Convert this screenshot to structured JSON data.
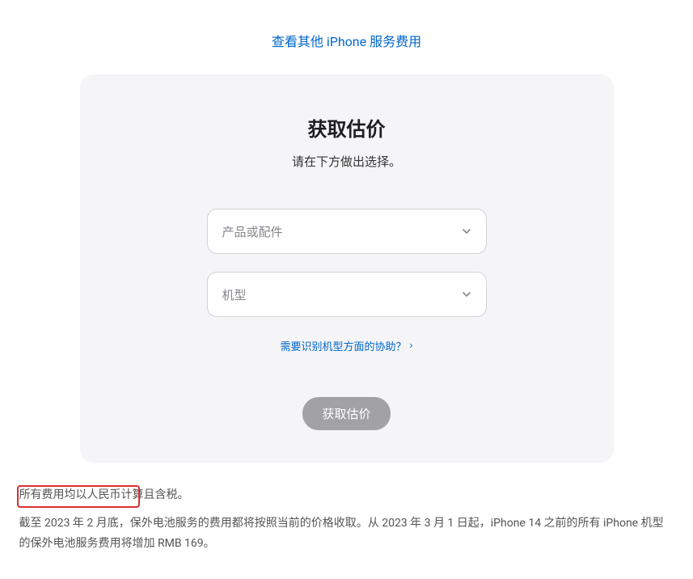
{
  "topLink": {
    "label": "查看其他 iPhone 服务费用"
  },
  "card": {
    "title": "获取估价",
    "subtitle": "请在下方做出选择。",
    "select1Placeholder": "产品或配件",
    "select2Placeholder": "机型",
    "helpLinkText": "需要识别机型方面的协助？",
    "helpLinkArrow": "›",
    "buttonLabel": "获取估价"
  },
  "footer": {
    "line1": "所有费用均以人民币计算且含税。",
    "line2": "截至 2023 年 2 月底，保外电池服务的费用都将按照当前的价格收取。从 2023 年 3 月 1 日起，iPhone 14 之前的所有 iPhone 机型的保外电池服务费用将增加 RMB 169。"
  }
}
